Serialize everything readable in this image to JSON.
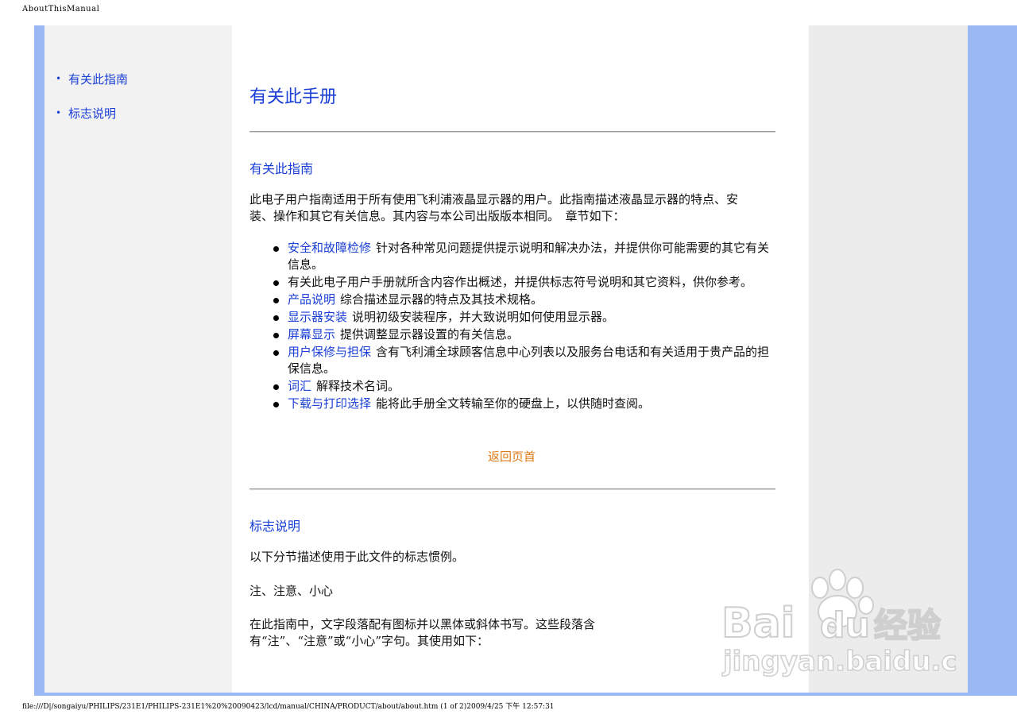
{
  "print_header": "AboutThisManual",
  "print_footer": "file:///D|/songaiyu/PHILIPS/231E1/PHILIPS-231E1%20%20090423/lcd/manual/CHINA/PRODUCT/about/about.htm (1 of 2)2009/4/25 下午 12:57:31",
  "nav": {
    "items": [
      {
        "label": "有关此指南"
      },
      {
        "label": "标志说明"
      }
    ]
  },
  "main": {
    "title": "有关此手册",
    "section1": {
      "heading": "有关此指南",
      "intro": "此电子用户指南适用于所有使用飞利浦液晶显示器的用户。此指南描述液晶显示器的特点、安装、操作和其它有关信息。其内容与本公司出版版本相同。　章节如下：",
      "items": [
        {
          "link": "安全和故障检修",
          "text": "针对各种常见问题提供提示说明和解决办法，并提供你可能需要的其它有关信息。"
        },
        {
          "link": "",
          "text": "有关此电子用户手册就所含内容作出概述，并提供标志符号说明和其它资料，供你参考。"
        },
        {
          "link": "产品说明",
          "text": "综合描述显示器的特点及其技术规格。"
        },
        {
          "link": "显示器安装",
          "text": "说明初级安装程序，并大致说明如何使用显示器。"
        },
        {
          "link": "屏幕显示",
          "text": "提供调整显示器设置的有关信息。"
        },
        {
          "link": "用户保修与担保",
          "text": "含有飞利浦全球顾客信息中心列表以及服务台电话和有关适用于贵产品的担保信息。"
        },
        {
          "link": "词汇",
          "text": "解释技术名词。"
        },
        {
          "link": "下载与打印选择",
          "text": "能将此手册全文转输至你的硬盘上，以供随时查阅。"
        }
      ],
      "back_link": "返回页首"
    },
    "section2": {
      "heading": "标志说明",
      "p1": "以下分节描述使用于此文件的标志惯例。",
      "p2": "注、注意、小心",
      "p3": "在此指南中，文字段落配有图标并以黑体或斜体书写。这些段落含有“注”、“注意”或“小心”字句。其使用如下："
    }
  },
  "watermark": {
    "brand": "Bai du 经验",
    "url": "jingyan.baidu.com"
  }
}
